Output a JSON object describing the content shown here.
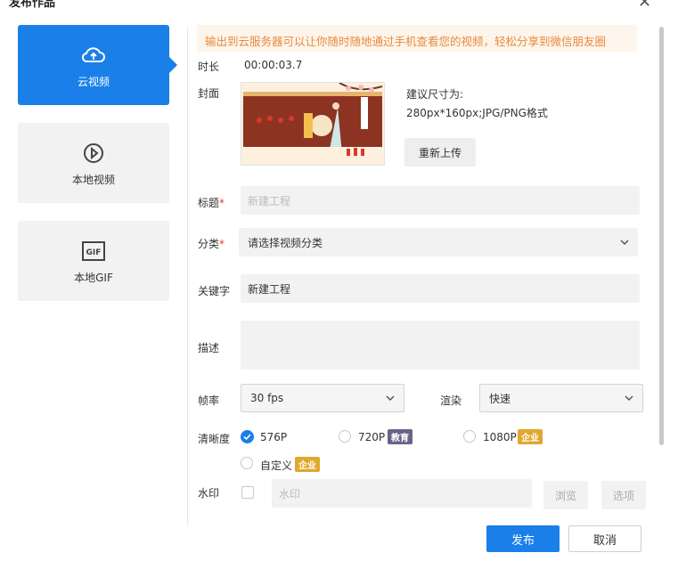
{
  "dialog": {
    "title": "发布作品"
  },
  "nav": [
    {
      "label": "云视频",
      "icon": "cloud-upload-icon",
      "active": true
    },
    {
      "label": "本地视频",
      "icon": "play-circle-icon",
      "active": false
    },
    {
      "label": "本地GIF",
      "icon": "gif-icon",
      "active": false
    }
  ],
  "banner": "输出到云服务器可以让你随时随地通过手机查看您的视频，轻松分享到微信朋友圈",
  "form": {
    "duration_label": "时长",
    "duration_value": "00:00:03.7",
    "cover_label": "封面",
    "cover_hint_1": "建议尺寸为:",
    "cover_hint_2": "280px*160px;JPG/PNG格式",
    "reupload": "重新上传",
    "title_label": "标题",
    "title_placeholder": "新建工程",
    "category_label": "分类",
    "category_value": "请选择视频分类",
    "keywords_label": "关键字",
    "keywords_value": "新建工程",
    "desc_label": "描述",
    "desc_value": "",
    "fps_label": "帧率",
    "fps_value": "30 fps",
    "render_label": "渲染",
    "render_value": "快速",
    "resolution_label": "清晰度",
    "resolutions": [
      {
        "label": "576P",
        "checked": true,
        "tag": ""
      },
      {
        "label": "720P",
        "checked": false,
        "tag": "教育"
      },
      {
        "label": "1080P",
        "checked": false,
        "tag": "企业"
      },
      {
        "label": "自定义",
        "checked": false,
        "tag": "企业"
      }
    ],
    "watermark_label": "水印",
    "watermark_placeholder": "水印",
    "browse": "浏览",
    "options": "选项"
  },
  "actions": {
    "publish": "发布",
    "cancel": "取消"
  },
  "colors": {
    "primary": "#1a7fe8",
    "banner_text": "#e98a3b",
    "banner_bg": "#fdf5ec",
    "tag_edu": "#6b6289",
    "tag_ent": "#e0a82e"
  }
}
